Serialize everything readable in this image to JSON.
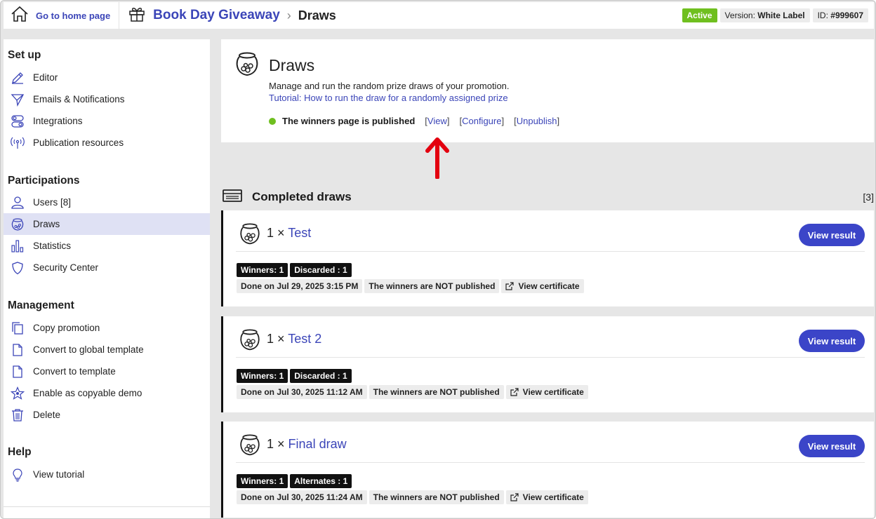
{
  "topbar": {
    "home_label": "Go to home page",
    "promotion_name": "Book Day Giveaway",
    "current_page": "Draws",
    "status": "Active",
    "version_label": "Version:",
    "version_value": "White Label",
    "id_label": "ID:",
    "id_value": "#999607"
  },
  "sidebar": {
    "setup_title": "Set up",
    "setup": [
      {
        "label": "Editor",
        "icon": "pencil-icon"
      },
      {
        "label": "Emails & Notifications",
        "icon": "paper-plane-icon"
      },
      {
        "label": "Integrations",
        "icon": "toggles-icon"
      },
      {
        "label": "Publication resources",
        "icon": "antenna-icon"
      }
    ],
    "participations_title": "Participations",
    "participations": [
      {
        "label": "Users [8]",
        "icon": "user-icon"
      },
      {
        "label": "Draws",
        "icon": "draw-bowl-icon",
        "active": true
      },
      {
        "label": "Statistics",
        "icon": "bar-chart-icon"
      },
      {
        "label": "Security Center",
        "icon": "shield-icon"
      }
    ],
    "management_title": "Management",
    "management": [
      {
        "label": "Copy promotion",
        "icon": "copy-icon"
      },
      {
        "label": "Convert to global template",
        "icon": "document-icon"
      },
      {
        "label": "Convert to template",
        "icon": "document-icon"
      },
      {
        "label": "Enable as copyable demo",
        "icon": "star-icon"
      },
      {
        "label": "Delete",
        "icon": "trash-icon"
      }
    ],
    "help_title": "Help",
    "help": [
      {
        "label": "View tutorial",
        "icon": "lightbulb-icon"
      }
    ]
  },
  "draws_panel": {
    "title": "Draws",
    "description": "Manage and run the random prize draws of your promotion.",
    "tutorial_link": "Tutorial: How to run the draw for a randomly assigned prize",
    "status_text": "The winners page is published",
    "view_link": "View",
    "configure_link": "Configure",
    "unpublish_link": "Unpublish"
  },
  "completed": {
    "title": "Completed draws",
    "count": "[3]",
    "view_result_label": "View result",
    "draws": [
      {
        "quantity": "1 ×",
        "name": "Test",
        "tags": [
          "Winners: 1",
          "Discarded : 1"
        ],
        "done": "Done on Jul 29, 2025 3:15 PM",
        "published": "The winners are NOT published",
        "certificate": "View certificate"
      },
      {
        "quantity": "1 ×",
        "name": "Test 2",
        "tags": [
          "Winners: 1",
          "Discarded : 1"
        ],
        "done": "Done on Jul 30, 2025 11:12 AM",
        "published": "The winners are NOT published",
        "certificate": "View certificate"
      },
      {
        "quantity": "1 ×",
        "name": "Final draw",
        "tags": [
          "Winners: 1",
          "Alternates : 1"
        ],
        "done": "Done on Jul 30, 2025 11:24 AM",
        "published": "The winners are NOT published",
        "certificate": "View certificate"
      }
    ]
  },
  "colors": {
    "accent": "#3b45b8",
    "button": "#3b45c8",
    "active_green": "#6fbf1f",
    "annotation_arrow": "#e3000f",
    "sidebar_active": "#dfe1f4"
  }
}
